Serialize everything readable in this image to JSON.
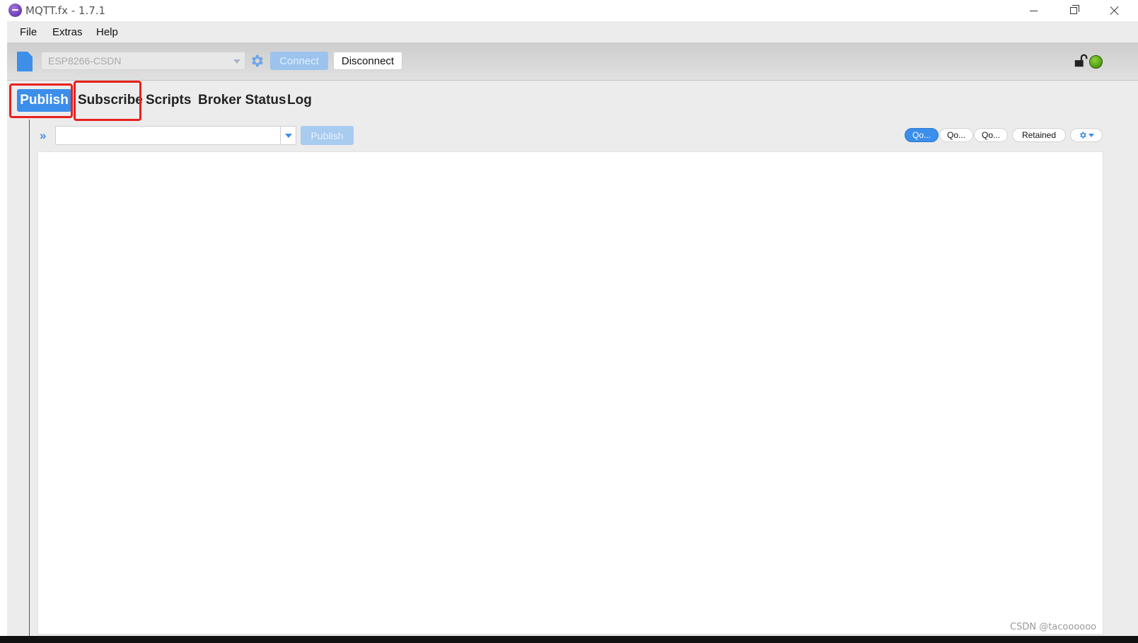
{
  "window": {
    "title": "MQTT.fx - 1.7.1"
  },
  "menu": {
    "items": [
      "File",
      "Extras",
      "Help"
    ]
  },
  "toolbar": {
    "profile": "ESP8266-CSDN",
    "connect_label": "Connect",
    "disconnect_label": "Disconnect",
    "connection_status_color": "#4f9b14"
  },
  "tabs": [
    {
      "label": "Publish",
      "active": true
    },
    {
      "label": "Subscribe",
      "active": false
    },
    {
      "label": "Scripts",
      "active": false
    },
    {
      "label": "Broker Status",
      "active": false
    },
    {
      "label": "Log",
      "active": false
    }
  ],
  "publish": {
    "expand_symbol": "»",
    "topic_value": "",
    "publish_button_label": "Publish",
    "qos": [
      {
        "label": "Qo...",
        "selected": true
      },
      {
        "label": "Qo...",
        "selected": false
      },
      {
        "label": "Qo...",
        "selected": false
      }
    ],
    "retained_label": "Retained",
    "payload": ""
  },
  "colors": {
    "accent": "#3b8eea",
    "highlight_box": "#e8211c"
  },
  "watermark": "CSDN @tacoooooo"
}
